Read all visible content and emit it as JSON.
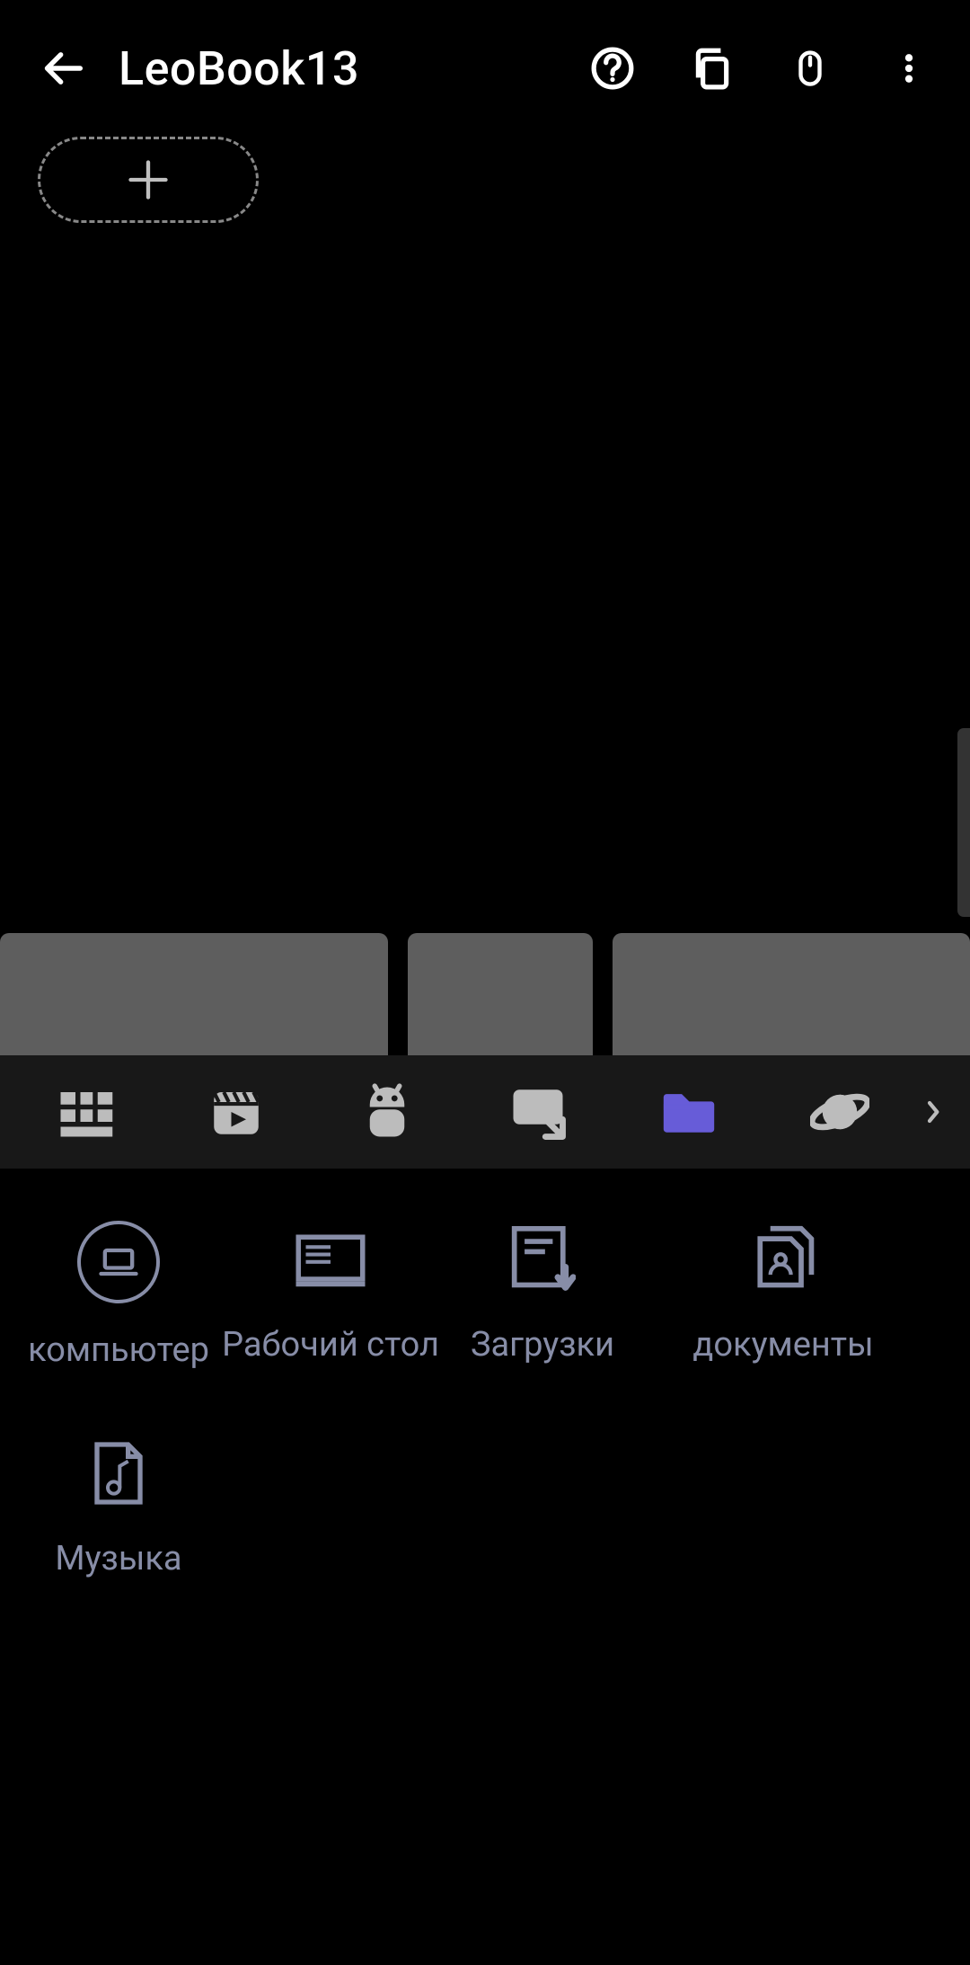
{
  "header": {
    "title": "LeoBook13"
  },
  "actions": {
    "help": "help-icon",
    "copy": "copy-icon",
    "mouse": "mouse-icon",
    "overflow": "more-icon"
  },
  "toolbar": {
    "items": [
      {
        "name": "keypad-icon",
        "active": false
      },
      {
        "name": "video-icon",
        "active": false
      },
      {
        "name": "android-icon",
        "active": false
      },
      {
        "name": "display-share-icon",
        "active": false
      },
      {
        "name": "folder-icon",
        "active": true
      },
      {
        "name": "planet-icon",
        "active": false
      }
    ]
  },
  "folders": [
    {
      "id": "computer",
      "label": "компьютер",
      "icon": "laptop-icon",
      "circled": true
    },
    {
      "id": "desktop",
      "label": "Рабочий стол",
      "icon": "desktop-icon",
      "circled": false
    },
    {
      "id": "downloads",
      "label": "Загрузки",
      "icon": "download-icon",
      "circled": false
    },
    {
      "id": "documents",
      "label": "документы",
      "icon": "documents-icon",
      "circled": false
    },
    {
      "id": "music",
      "label": "Музыка",
      "icon": "music-icon",
      "circled": false
    }
  ],
  "colors": {
    "accent": "#675cd8",
    "muted": "#878da7",
    "panel": "#5e5e5e",
    "toolbar": "#181818"
  }
}
